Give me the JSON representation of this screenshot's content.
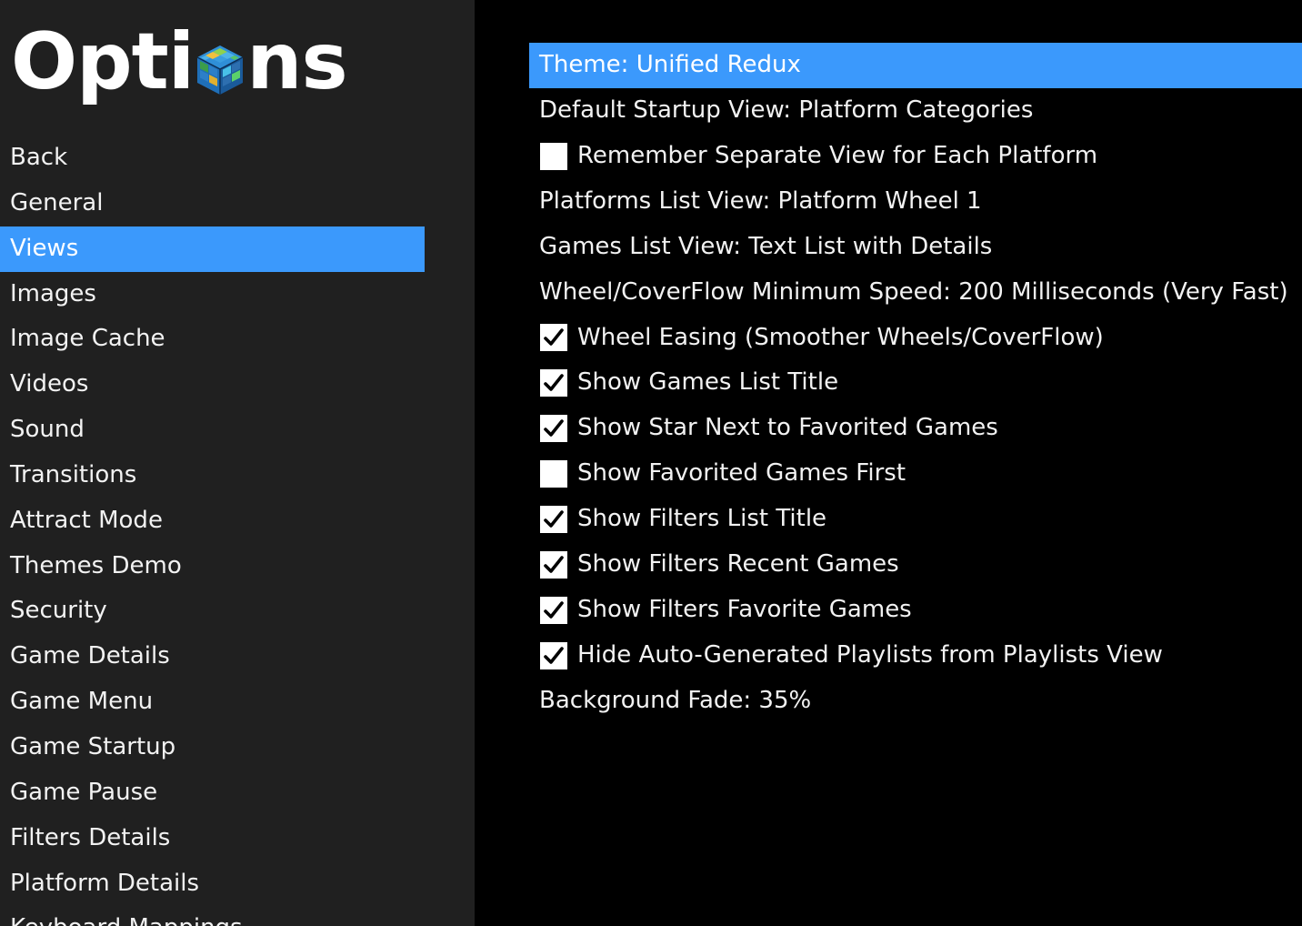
{
  "header": {
    "title_prefix": "Opti",
    "title_suffix": "ns",
    "logo_icon": "cube-logo-icon"
  },
  "sidebar": {
    "selected_index": 2,
    "items": [
      {
        "label": "Back"
      },
      {
        "label": "General"
      },
      {
        "label": "Views"
      },
      {
        "label": "Images"
      },
      {
        "label": "Image Cache"
      },
      {
        "label": "Videos"
      },
      {
        "label": "Sound"
      },
      {
        "label": "Transitions"
      },
      {
        "label": "Attract Mode"
      },
      {
        "label": "Themes Demo"
      },
      {
        "label": "Security"
      },
      {
        "label": "Game Details"
      },
      {
        "label": "Game Menu"
      },
      {
        "label": "Game Startup"
      },
      {
        "label": "Game Pause"
      },
      {
        "label": "Filters Details"
      },
      {
        "label": "Platform Details"
      },
      {
        "label": "Keyboard Mappings"
      }
    ]
  },
  "settings": {
    "selected_index": 0,
    "items": [
      {
        "label": "Theme: Unified Redux",
        "type": "value"
      },
      {
        "label": "Default Startup View: Platform Categories",
        "type": "value"
      },
      {
        "label": "Remember Separate View for Each Platform",
        "type": "checkbox",
        "checked": false
      },
      {
        "label": "Platforms List View: Platform Wheel 1",
        "type": "value"
      },
      {
        "label": "Games List View: Text List with Details",
        "type": "value"
      },
      {
        "label": "Wheel/CoverFlow Minimum Speed: 200 Milliseconds (Very Fast)",
        "type": "value"
      },
      {
        "label": "Wheel Easing (Smoother Wheels/CoverFlow)",
        "type": "checkbox",
        "checked": true
      },
      {
        "label": "Show Games List Title",
        "type": "checkbox",
        "checked": true
      },
      {
        "label": "Show Star Next to Favorited Games",
        "type": "checkbox",
        "checked": true
      },
      {
        "label": "Show Favorited Games First",
        "type": "checkbox",
        "checked": false
      },
      {
        "label": "Show Filters List Title",
        "type": "checkbox",
        "checked": true
      },
      {
        "label": "Show Filters Recent Games",
        "type": "checkbox",
        "checked": true
      },
      {
        "label": "Show Filters Favorite Games",
        "type": "checkbox",
        "checked": true
      },
      {
        "label": "Hide Auto-Generated Playlists from Playlists View",
        "type": "checkbox",
        "checked": true
      },
      {
        "label": "Background Fade: 35%",
        "type": "value"
      }
    ]
  },
  "colors": {
    "sidebar_bg": "#202020",
    "main_bg": "#000000",
    "selection": "#3b99fc",
    "text": "#f2f2f2"
  }
}
